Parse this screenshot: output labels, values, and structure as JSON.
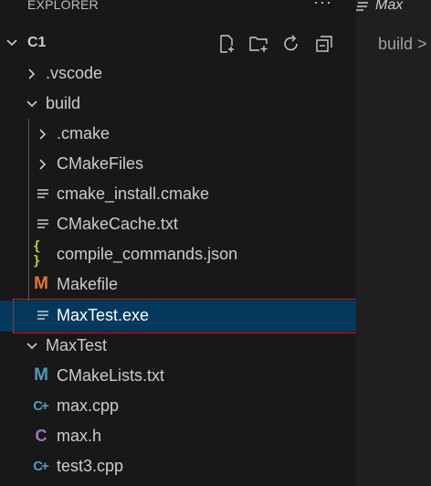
{
  "explorer": {
    "title": "EXPLORER",
    "more": "···",
    "root": {
      "label": "C1"
    }
  },
  "tree": [
    {
      "label": ".vscode",
      "icon": "chevron-right-icon"
    },
    {
      "label": "build",
      "icon": "chevron-down-icon"
    },
    {
      "label": ".cmake",
      "icon": "chevron-right-icon"
    },
    {
      "label": "CMakeFiles",
      "icon": "chevron-right-icon"
    },
    {
      "label": "cmake_install.cmake",
      "icon": "text-file-icon"
    },
    {
      "label": "CMakeCache.txt",
      "icon": "text-file-icon"
    },
    {
      "label": "compile_commands.json",
      "icon": "json-icon",
      "glyph": "{ }"
    },
    {
      "label": "Makefile",
      "icon": "makefile-icon",
      "glyph": "M"
    },
    {
      "label": "MaxTest.exe",
      "icon": "text-file-icon",
      "selected": true
    },
    {
      "label": "MaxTest",
      "icon": "chevron-down-icon"
    },
    {
      "label": "CMakeLists.txt",
      "icon": "cmake-m-icon",
      "glyph": "M"
    },
    {
      "label": "max.cpp",
      "icon": "cpp-icon",
      "glyph": "C+"
    },
    {
      "label": "max.h",
      "icon": "c-header-icon",
      "glyph": "C"
    },
    {
      "label": "test3.cpp",
      "icon": "cpp-icon",
      "glyph": "C+"
    }
  ],
  "editor": {
    "tab_title": "Max",
    "breadcrumb": "build >"
  },
  "colors": {
    "selection": "#04395e",
    "highlight_box": "#e81123",
    "makefile": "#e37933",
    "json": "#cbcb41",
    "cmake_m": "#519aba",
    "cpp": "#519aba",
    "c_header": "#a074c4"
  }
}
